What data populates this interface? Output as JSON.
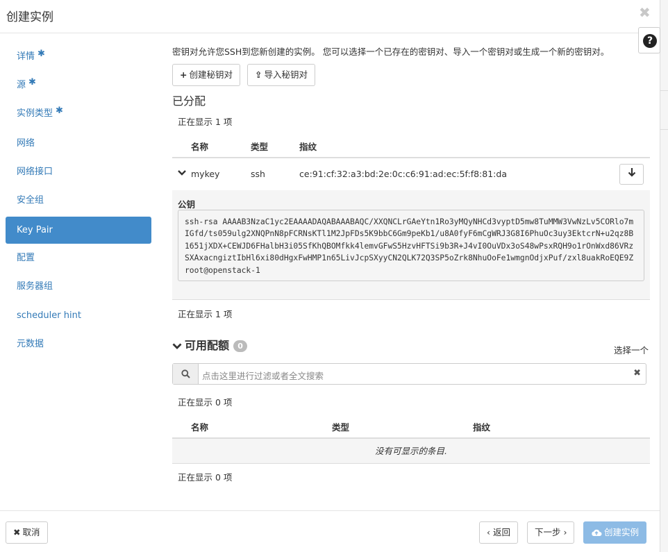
{
  "dialog": {
    "title": "创建实例",
    "close_glyph": "✖",
    "help_glyph": "?"
  },
  "sidebar": {
    "items": [
      {
        "label": "详情",
        "required": "✱"
      },
      {
        "label": "源",
        "required": "✱"
      },
      {
        "label": "实例类型",
        "required": "✱"
      },
      {
        "label": "网络"
      },
      {
        "label": "网络接口"
      },
      {
        "label": "安全组"
      },
      {
        "label": "Key Pair",
        "active": true
      },
      {
        "label": "配置"
      },
      {
        "label": "服务器组"
      },
      {
        "label": "scheduler hint"
      },
      {
        "label": "元数据"
      }
    ]
  },
  "main": {
    "description": "密钥对允许您SSH到您新创建的实例。 您可以选择一个已存在的密钥对、导入一个密钥对或生成一个新的密钥对。",
    "create_keypair_label": "创建秘钥对",
    "import_keypair_label": "导入秘钥对",
    "allocated": {
      "heading": "已分配",
      "showing_top": "正在显示 1 项",
      "showing_bottom": "正在显示 1 项",
      "columns": [
        "名称",
        "类型",
        "指纹"
      ],
      "rows": [
        {
          "name": "mykey",
          "type": "ssh",
          "fingerprint": "ce:91:cf:32:a3:bd:2e:0c:c6:91:ad:ec:5f:f8:81:da",
          "public_key_label": "公钥",
          "public_key": "ssh-rsa AAAAB3NzaC1yc2EAAAADAQABAAABAQC/XXQNCLrGAeYtn1Ro3yMQyNHCd3vyptD5mw8TuMMW3VwNzLv5CORlo7mIGfd/ts059ulg2XNQPnN8pFCRNsKTl1M2JpFDs5K9bbC6Gm9peKb1/u8A0fyF6mCgWRJ3G8I6PhuOc3uy3EktcrN+u2qz8B1651jXDX+CEWJD6FHalbH3i05SfKhQBOMfkk4lemvGFwS5HzvHFTSi9b3R+J4vI0OuVDx3oS48wPsxRQH9o1rOnWxd86VRzSXAxacngiztIbHl6xi80dHgxFwHMP1n65LivJcpSXyyCN2QLK72Q3SP5oZrk8NhuOoFe1wmgnOdjxPuf/zxl8uakRoEQE9Z root@openstack-1"
        }
      ]
    },
    "available": {
      "heading": "可用配额",
      "count": "0",
      "select_one": "选择一个",
      "search_placeholder": "点击这里进行过滤或者全文搜索",
      "showing_top": "正在显示 0 项",
      "showing_bottom": "正在显示 0 项",
      "columns": [
        "名称",
        "类型",
        "指纹"
      ],
      "empty_text": "没有可显示的条目."
    }
  },
  "footer": {
    "cancel_label": "取消",
    "back_label": "‹ 返回",
    "next_label": "下一步 ›",
    "create_label": "创建实例"
  }
}
